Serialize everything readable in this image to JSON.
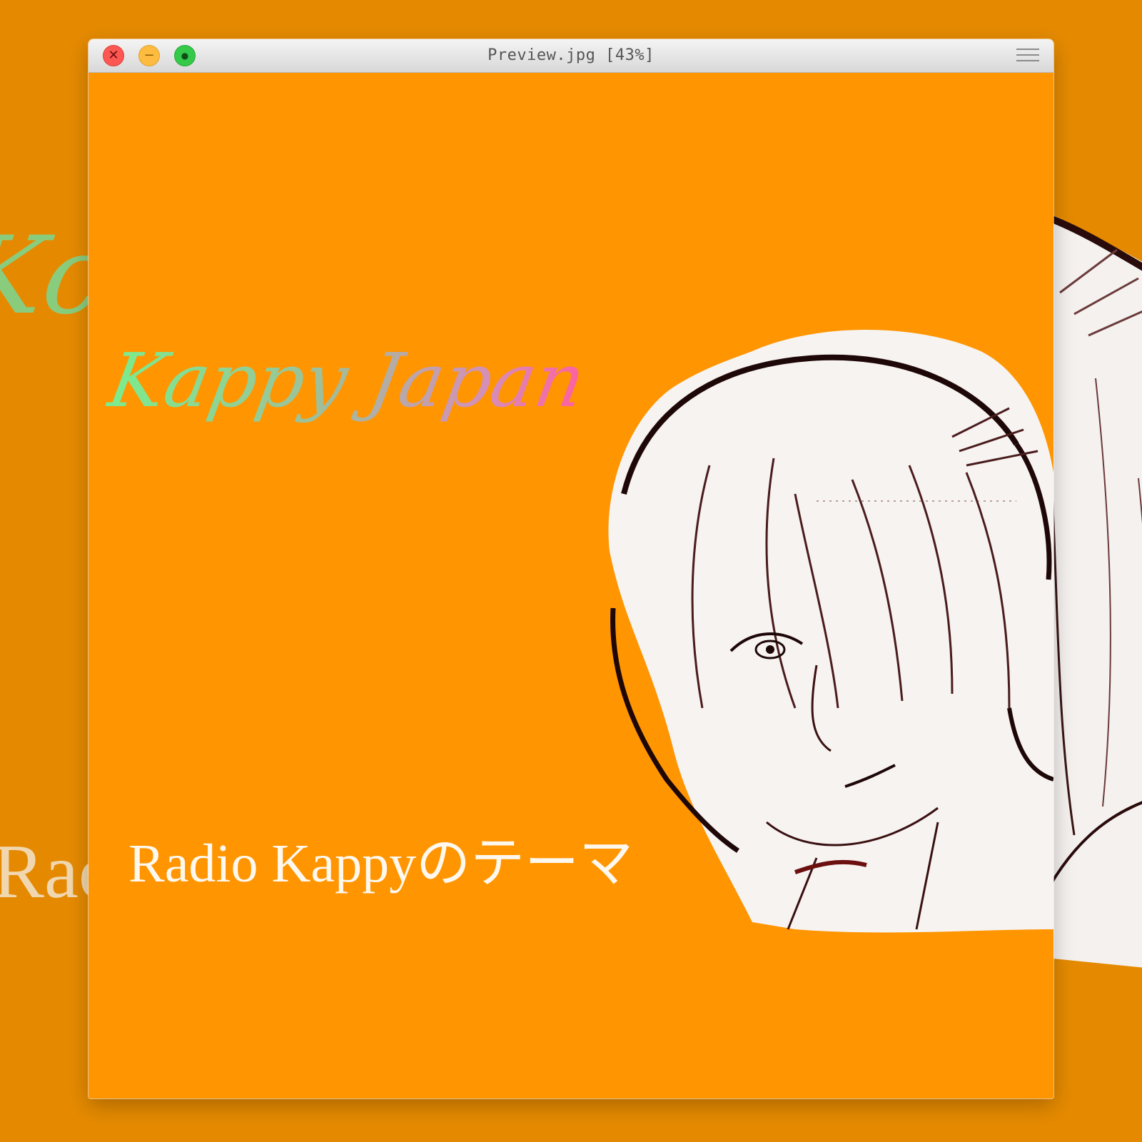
{
  "window": {
    "title": "Preview.jpg [43%]",
    "controls": {
      "close_glyph": "✕",
      "minimize_glyph": "−",
      "zoom_glyph": "●"
    },
    "menu_icon": "hamburger-menu-icon"
  },
  "image": {
    "script_title": "Kappy Japan",
    "caption": "Radio Kappyのテーマ",
    "background_color": "#ff9500"
  },
  "backdrop": {
    "script_title_fragment": "Kc",
    "caption_fragment": "Rac",
    "background_color": "#e58a00"
  },
  "colors": {
    "close": "#fc5753",
    "minimize": "#fdbc40",
    "zoom": "#35c94a"
  }
}
